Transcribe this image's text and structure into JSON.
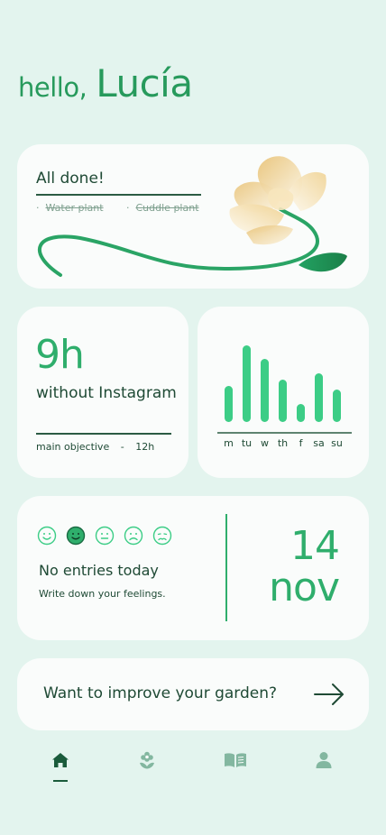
{
  "greeting": {
    "hello": "hello,",
    "name": "Lucía"
  },
  "tasks_card": {
    "title": "All done!",
    "tasks": [
      {
        "label": "Water plant",
        "done": true
      },
      {
        "label": "Cuddle plant",
        "done": true
      }
    ]
  },
  "screen_time": {
    "value": "9h",
    "label": "without Instagram",
    "objective_label": "main objective",
    "separator": "-",
    "objective_value": "12h"
  },
  "weekly_chart": {
    "chart_data": {
      "type": "bar",
      "categories": [
        "m",
        "tu",
        "w",
        "th",
        "f",
        "sa",
        "su"
      ],
      "values": [
        40,
        85,
        70,
        47,
        20,
        54,
        36
      ],
      "ylim": [
        0,
        100
      ]
    }
  },
  "mood_card": {
    "faces": [
      "happy",
      "smile",
      "neutral",
      "sad",
      "tired"
    ],
    "selected": 1,
    "title": "No entries today",
    "subtitle": "Write down your feelings.",
    "day": "14",
    "month": "nov"
  },
  "garden_card": {
    "question": "Want to improve your garden?"
  },
  "nav": {
    "items": [
      "home-icon",
      "plant-icon",
      "journal-icon",
      "profile-icon"
    ],
    "active": "home-icon"
  },
  "colors": {
    "background": "#e3f4ee",
    "accent": "#2fae6c",
    "bar": "#3ccd86",
    "text": "#1f4a35",
    "nav_inactive": "#83b7a0",
    "nav_active": "#1a5b3b"
  }
}
